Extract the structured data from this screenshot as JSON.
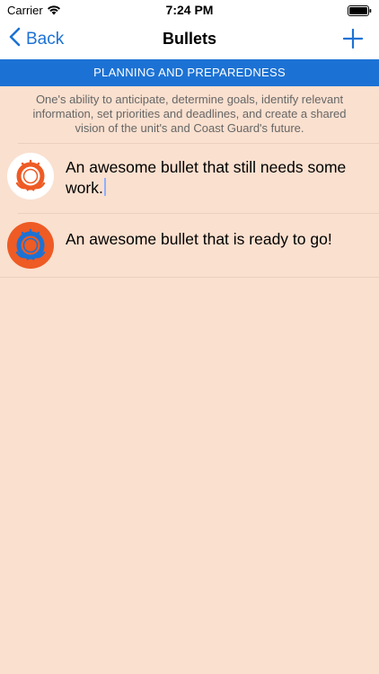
{
  "status_bar": {
    "carrier": "Carrier",
    "time": "7:24 PM"
  },
  "nav": {
    "back_label": "Back",
    "title": "Bullets",
    "add_icon": "plus-icon"
  },
  "section": {
    "header": "PLANNING AND PREPAREDNESS",
    "description": "One's ability to anticipate, determine goals, identify relevant information, set priorities and deadlines, and create a shared vision of the unit's and Coast Guard's future."
  },
  "bullets": [
    {
      "text": "An awesome bullet that still needs some work.",
      "status": "needs-work",
      "icon": "coast-guard-emblem-icon"
    },
    {
      "text": "An awesome bullet that is ready to go!",
      "status": "ready",
      "icon": "coast-guard-emblem-icon"
    }
  ],
  "colors": {
    "accent": "#1c72d4",
    "background": "#fae0cf",
    "emblem_orange": "#ee5b24",
    "emblem_blue": "#1c72d4"
  }
}
